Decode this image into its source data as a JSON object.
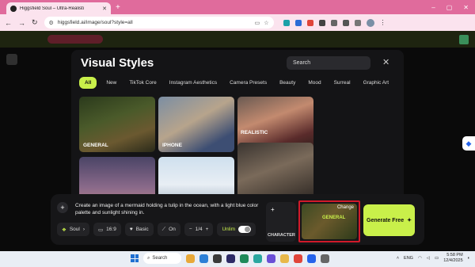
{
  "browser": {
    "tab_title": "Higgsfield Soul – Ultra-Realisti",
    "new_tab": "+",
    "address": "higgsfield.ai/image/soul?style=all",
    "window_controls": [
      "–",
      "▢",
      "✕"
    ]
  },
  "modal": {
    "title": "Visual Styles",
    "search_placeholder": "Search",
    "close": "✕",
    "categories": [
      "All",
      "New",
      "TikTok Core",
      "Instagram Aesthetics",
      "Camera Presets",
      "Beauty",
      "Mood",
      "Surreal",
      "Graphic Art"
    ],
    "active_category": "All",
    "cards": [
      {
        "label": "GENERAL"
      },
      {
        "label": "IPHONE"
      },
      {
        "label": "REALISTIC"
      },
      {
        "label": ""
      },
      {
        "label": ""
      },
      {
        "label": ""
      }
    ]
  },
  "prompt_bar": {
    "prompt_text": "Create an image of a mermaid holding a tulip in the ocean, with a light blue color palette and sunlight shining in.",
    "controls": {
      "model": "Soul",
      "aspect": "16:9",
      "quality": "Basic",
      "enhance": "On",
      "count": "1/4",
      "unlim": "Unlim"
    },
    "character_label": "CHARACTER",
    "style_preview": {
      "label": "GENERAL",
      "change": "Change"
    },
    "generate_label": "Generate Free"
  },
  "taskbar": {
    "search": "Search",
    "lang": "ENG",
    "time": "5:58 PM",
    "date": "12/4/2025"
  },
  "colors": {
    "accent": "#c9f04a",
    "highlight_border": "#d11a2a",
    "browser_pink": "#e06b9c"
  }
}
